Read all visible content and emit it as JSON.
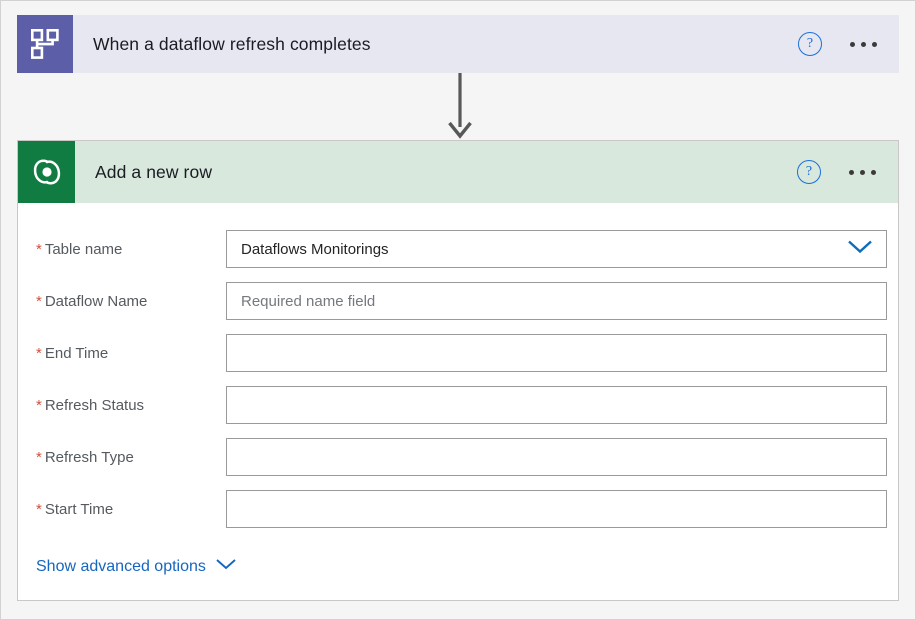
{
  "flow": {
    "trigger": {
      "title": "When a dataflow refresh completes",
      "icon": "dataflow-icon",
      "header_color": "#e7e7f1",
      "icon_bg": "#5c5fa8",
      "help_label": "?",
      "menu_label": "..."
    },
    "connector": {
      "icon": "arrow-down-icon"
    },
    "action": {
      "title": "Add a new row",
      "icon": "dataverse-icon",
      "header_color": "#d8e8dd",
      "icon_bg": "#107c41",
      "help_label": "?",
      "menu_label": "...",
      "fields": [
        {
          "label": "Table name",
          "required": true,
          "type": "combobox",
          "value": "Dataflows Monitorings",
          "placeholder": "",
          "is_placeholder": false
        },
        {
          "label": "Dataflow Name",
          "required": true,
          "type": "text",
          "value": "",
          "placeholder": "Required name field",
          "is_placeholder": true
        },
        {
          "label": "End Time",
          "required": true,
          "type": "text",
          "value": "",
          "placeholder": "",
          "is_placeholder": false
        },
        {
          "label": "Refresh Status",
          "required": true,
          "type": "text",
          "value": "",
          "placeholder": "",
          "is_placeholder": false
        },
        {
          "label": "Refresh Type",
          "required": true,
          "type": "text",
          "value": "",
          "placeholder": "",
          "is_placeholder": false
        },
        {
          "label": "Start Time",
          "required": true,
          "type": "text",
          "value": "",
          "placeholder": "",
          "is_placeholder": false
        }
      ],
      "advanced": {
        "label": "Show advanced options",
        "icon": "chevron-down-icon"
      }
    }
  },
  "colors": {
    "accent_blue": "#1666c0",
    "required_red": "#d0503c",
    "trigger_purple": "#5c5fa8",
    "action_green": "#107c41",
    "page_bg": "#f5f5f5"
  }
}
